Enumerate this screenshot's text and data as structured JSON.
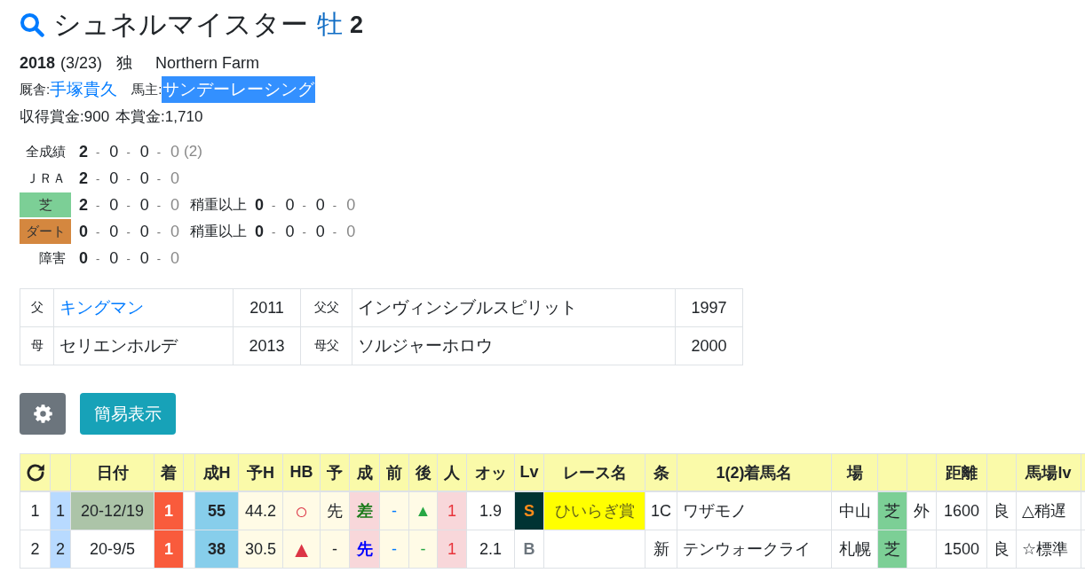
{
  "header": {
    "title": "シュネルマイスター",
    "sex": "牡",
    "age": "2"
  },
  "profile": {
    "birth_year": "2018",
    "birth_date": "(3/23)",
    "origin": "独",
    "breeder": "Northern Farm",
    "trainer_label": "厩舎:",
    "trainer": "手塚貴久",
    "owner_label": "馬主:",
    "owner": "サンデーレーシング",
    "owner_highlighted": true,
    "prizes": [
      "収得賞金:900",
      "本賞金:1,710"
    ]
  },
  "records": {
    "separator": "-",
    "rows": [
      {
        "label": "全成績",
        "kind": "plain",
        "counts": [
          "2",
          "0",
          "0",
          "0"
        ],
        "note": "(2)"
      },
      {
        "label": "ＪＲＡ",
        "kind": "plain",
        "counts": [
          "2",
          "0",
          "0",
          "0"
        ]
      },
      {
        "label": "芝",
        "kind": "badge",
        "color": "#7ccf96",
        "counts": [
          "2",
          "0",
          "0",
          "0"
        ],
        "heavy": {
          "label": "稍重以上",
          "counts": [
            "0",
            "0",
            "0",
            "0"
          ]
        }
      },
      {
        "label": "ダート",
        "kind": "badge",
        "color": "#d4873f",
        "counts": [
          "0",
          "0",
          "0",
          "0"
        ],
        "heavy": {
          "label": "稍重以上",
          "counts": [
            "0",
            "0",
            "0",
            "0"
          ]
        }
      },
      {
        "label": "障害",
        "kind": "plain",
        "counts": [
          "0",
          "0",
          "0",
          "0"
        ]
      }
    ]
  },
  "pedigree": {
    "rows": [
      {
        "relation": "父",
        "name": "キングマン",
        "link": true,
        "year": "2011",
        "sire_relation": "父父",
        "sire_name": "インヴィンシブルスピリット",
        "sire_year": "1997"
      },
      {
        "relation": "母",
        "name": "セリエンホルデ",
        "link": false,
        "year": "2013",
        "sire_relation": "母父",
        "sire_name": "ソルジャーホロウ",
        "sire_year": "2000"
      }
    ]
  },
  "toolbar": {
    "buttons": [
      {
        "kind": "settings"
      },
      {
        "kind": "text",
        "label": "簡易表示"
      }
    ]
  },
  "race_table": {
    "columns": [
      {
        "kind": "reload"
      },
      {
        "kind": "blank"
      },
      {
        "kind": "text",
        "label": "日付"
      },
      {
        "kind": "text",
        "label": "着"
      },
      {
        "kind": "blank"
      },
      {
        "kind": "text",
        "label": "成H"
      },
      {
        "kind": "text",
        "label": "予H"
      },
      {
        "kind": "text",
        "label": "HB"
      },
      {
        "kind": "text",
        "label": "予"
      },
      {
        "kind": "text",
        "label": "成"
      },
      {
        "kind": "text",
        "label": "前"
      },
      {
        "kind": "text",
        "label": "後"
      },
      {
        "kind": "text",
        "label": "人"
      },
      {
        "kind": "text",
        "label": "オッ"
      },
      {
        "kind": "text",
        "label": "Lv"
      },
      {
        "kind": "text",
        "label": "レース名"
      },
      {
        "kind": "text",
        "label": "条"
      },
      {
        "kind": "text",
        "label": "1(2)着馬名"
      },
      {
        "kind": "text",
        "label": "場"
      },
      {
        "kind": "blank"
      },
      {
        "kind": "blank"
      },
      {
        "kind": "text",
        "label": "距離"
      },
      {
        "kind": "blank"
      },
      {
        "kind": "text",
        "label": "馬場lv"
      },
      {
        "kind": "blank"
      }
    ],
    "rows": [
      {
        "cells": [
          {
            "text": "1"
          },
          {
            "text": "1",
            "color": "#b8daff"
          },
          {
            "text": "20-12/19",
            "color": "#acc4a8"
          },
          {
            "text": "1",
            "color": "#f95b3c",
            "ink": {
              "color": "#ffffff"
            }
          },
          {},
          {
            "text": "55",
            "color": "#87ceeb"
          },
          {
            "text": "44.2",
            "color": "#fffbe6"
          },
          {
            "text": "○",
            "color": "#fffbe6",
            "ink": {
              "color": "#dc3545"
            }
          },
          {
            "text": "先",
            "color": "#fffbe6"
          },
          {
            "text": "差",
            "color": "#f8d7da",
            "ink": {
              "color": "#1a7a1a"
            }
          },
          {
            "text": "-",
            "color": "#fffbe6",
            "ink": {
              "color": "#007bff"
            }
          },
          {
            "text": "▲",
            "color": "#fffbe6",
            "ink": {
              "color": "#28a745"
            }
          },
          {
            "text": "1",
            "color": "#f8d7da",
            "ink": {
              "color": "#e8333a"
            }
          },
          {
            "text": "1.9"
          },
          {
            "text": "S",
            "color": "#003333",
            "ink": {
              "color": "#ff8c1a"
            }
          },
          {
            "text": "ひいらぎ賞",
            "color": "#ffff00",
            "ink": {
              "color": "#66661a"
            }
          },
          {
            "text": "1C"
          },
          {
            "text": "ワザモノ"
          },
          {
            "text": "中山"
          },
          {
            "text": "芝",
            "color": "#7ccf96"
          },
          {
            "text": "外"
          },
          {
            "text": "1600"
          },
          {
            "text": "良"
          },
          {
            "text": "△稍遅"
          },
          {}
        ]
      },
      {
        "cells": [
          {
            "text": "2"
          },
          {
            "text": "2",
            "color": "#b8daff"
          },
          {
            "text": "20-9/5"
          },
          {
            "text": "1",
            "color": "#f95b3c",
            "ink": {
              "color": "#ffffff"
            }
          },
          {},
          {
            "text": "38",
            "color": "#87ceeb"
          },
          {
            "text": "30.5",
            "color": "#fffbe6"
          },
          {
            "text": "▲",
            "color": "#fffbe6",
            "ink": {
              "color": "#dc3545"
            }
          },
          {
            "text": "-",
            "color": "#fffbe6"
          },
          {
            "text": "先",
            "color": "#f8d7da",
            "ink": {
              "color": "#0000ff"
            }
          },
          {
            "text": "-",
            "color": "#fffbe6",
            "ink": {
              "color": "#007bff"
            }
          },
          {
            "text": "-",
            "color": "#fffbe6",
            "ink": {
              "color": "#28a745"
            }
          },
          {
            "text": "1",
            "color": "#f8d7da",
            "ink": {
              "color": "#e8333a"
            }
          },
          {
            "text": "2.1"
          },
          {
            "text": "B",
            "ink": {
              "color": "#6c757d"
            }
          },
          {},
          {
            "text": "新"
          },
          {
            "text": "テンウォークライ"
          },
          {
            "text": "札幌"
          },
          {
            "text": "芝",
            "color": "#7ccf96"
          },
          {},
          {
            "text": "1500"
          },
          {
            "text": "良"
          },
          {
            "text": "☆標準"
          },
          {}
        ]
      }
    ]
  }
}
